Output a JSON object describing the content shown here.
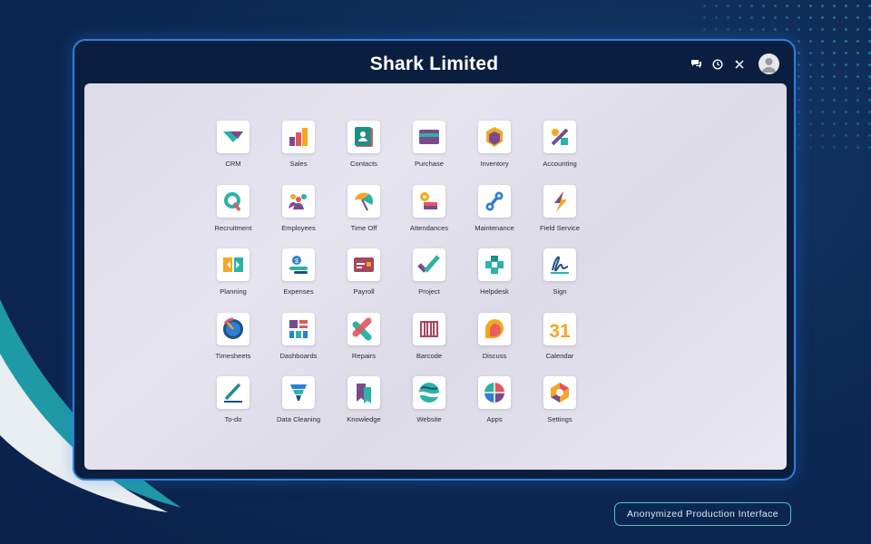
{
  "header": {
    "title": "Shark Limited"
  },
  "top_icons": [
    "chat-icon",
    "clock-icon",
    "tools-icon",
    "user-avatar"
  ],
  "apps": [
    {
      "label": "CRM",
      "icon": "crm-icon"
    },
    {
      "label": "Sales",
      "icon": "sales-icon"
    },
    {
      "label": "Contacts",
      "icon": "contacts-icon"
    },
    {
      "label": "Purchase",
      "icon": "purchase-icon"
    },
    {
      "label": "Inventory",
      "icon": "inventory-icon"
    },
    {
      "label": "Accounting",
      "icon": "accounting-icon"
    },
    {
      "label": "Recruitment",
      "icon": "recruitment-icon"
    },
    {
      "label": "Employees",
      "icon": "employees-icon"
    },
    {
      "label": "Time Off",
      "icon": "time-off-icon"
    },
    {
      "label": "Attendances",
      "icon": "attendances-icon"
    },
    {
      "label": "Maintenance",
      "icon": "maintenance-icon"
    },
    {
      "label": "Field Service",
      "icon": "field-service-icon"
    },
    {
      "label": "Planning",
      "icon": "planning-icon"
    },
    {
      "label": "Expenses",
      "icon": "expenses-icon"
    },
    {
      "label": "Payroll",
      "icon": "payroll-icon"
    },
    {
      "label": "Project",
      "icon": "project-icon"
    },
    {
      "label": "Helpdesk",
      "icon": "helpdesk-icon"
    },
    {
      "label": "Sign",
      "icon": "sign-icon"
    },
    {
      "label": "Timesheets",
      "icon": "timesheets-icon"
    },
    {
      "label": "Dashboards",
      "icon": "dashboards-icon"
    },
    {
      "label": "Repairs",
      "icon": "repairs-icon"
    },
    {
      "label": "Barcode",
      "icon": "barcode-icon"
    },
    {
      "label": "Discuss",
      "icon": "discuss-icon"
    },
    {
      "label": "Calendar",
      "icon": "calendar-icon",
      "glyph": "31"
    },
    {
      "label": "To-do",
      "icon": "todo-icon"
    },
    {
      "label": "Data Cleaning",
      "icon": "data-cleaning-icon"
    },
    {
      "label": "Knowledge",
      "icon": "knowledge-icon"
    },
    {
      "label": "Website",
      "icon": "website-icon"
    },
    {
      "label": "Apps",
      "icon": "apps-icon"
    },
    {
      "label": "Settings",
      "icon": "settings-icon"
    }
  ],
  "footer": {
    "badge": "Anonymized Production Interface"
  }
}
